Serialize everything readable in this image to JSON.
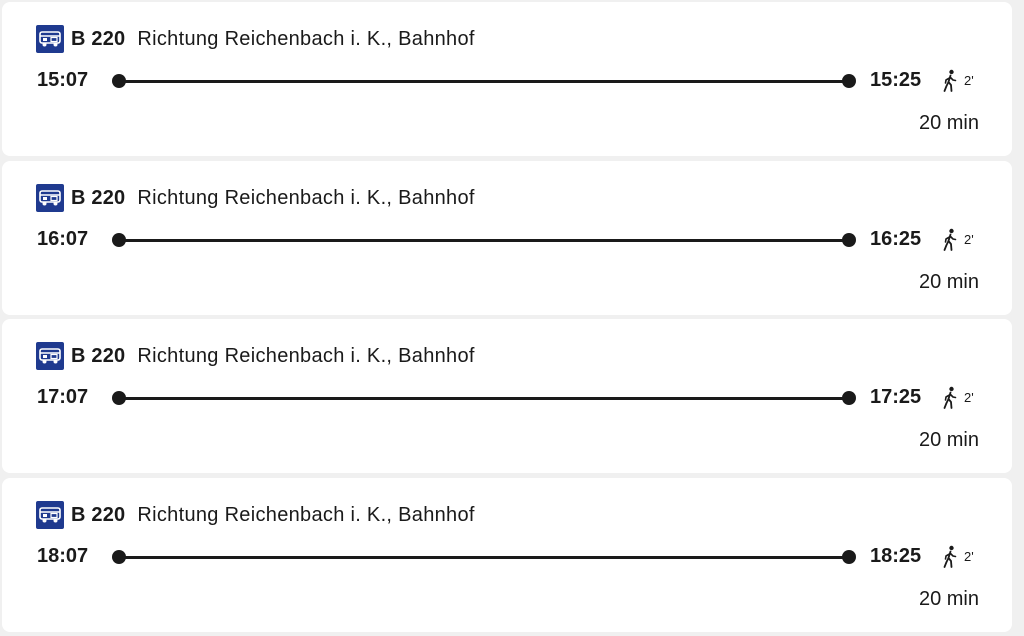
{
  "connections": [
    {
      "line": "B 220",
      "direction": "Richtung Reichenbach i. K., Bahnhof",
      "departure": "15:07",
      "arrival": "15:25",
      "walk": "2'",
      "duration": "20 min",
      "icon": "bus-icon"
    },
    {
      "line": "B 220",
      "direction": "Richtung Reichenbach i. K., Bahnhof",
      "departure": "16:07",
      "arrival": "16:25",
      "walk": "2'",
      "duration": "20 min",
      "icon": "bus-icon"
    },
    {
      "line": "B 220",
      "direction": "Richtung Reichenbach i. K., Bahnhof",
      "departure": "17:07",
      "arrival": "17:25",
      "walk": "2'",
      "duration": "20 min",
      "icon": "bus-icon"
    },
    {
      "line": "B 220",
      "direction": "Richtung Reichenbach i. K., Bahnhof",
      "departure": "18:07",
      "arrival": "18:25",
      "walk": "2'",
      "duration": "20 min",
      "icon": "bus-icon"
    }
  ],
  "colors": {
    "bus_badge": "#1f3a8f",
    "timeline": "#1a1a1a",
    "card_background": "#ffffff",
    "page_background": "#f0f0f0"
  }
}
